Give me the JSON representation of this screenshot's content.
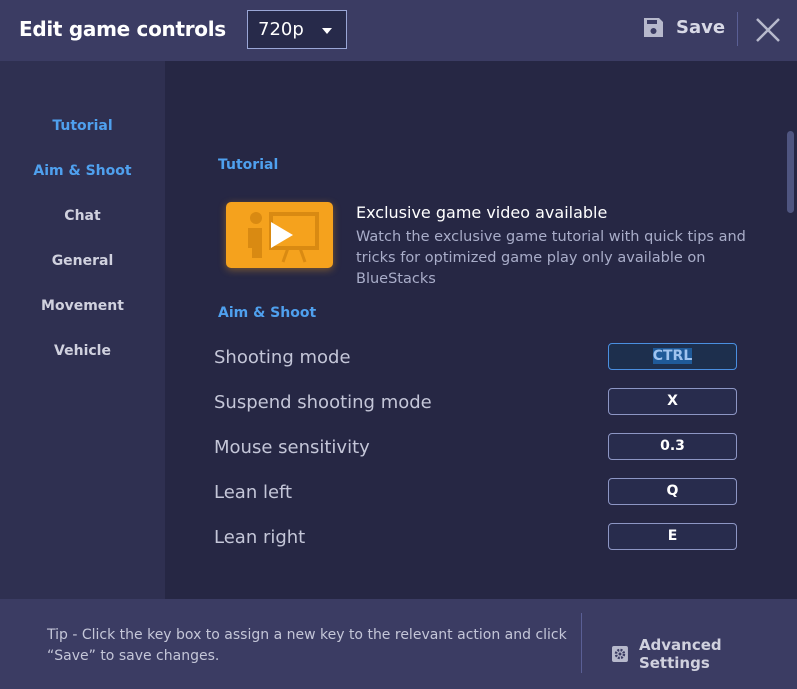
{
  "header": {
    "title": "Edit game controls",
    "resolution": "720p",
    "save_label": "Save"
  },
  "sidebar": {
    "items": [
      {
        "label": "Tutorial",
        "active": true
      },
      {
        "label": "Aim & Shoot",
        "active": true
      },
      {
        "label": "Chat"
      },
      {
        "label": "General"
      },
      {
        "label": "Movement"
      },
      {
        "label": "Vehicle"
      }
    ]
  },
  "main": {
    "tutorial_heading": "Tutorial",
    "video": {
      "title": "Exclusive game video available",
      "description": "Watch the exclusive game tutorial with quick tips and tricks for optimized game play only available on BlueStacks"
    },
    "aim_heading": "Aim & Shoot",
    "rows": [
      {
        "label": "Shooting mode",
        "key": "CTRL"
      },
      {
        "label": "Suspend shooting mode",
        "key": "X"
      },
      {
        "label": "Mouse sensitivity",
        "key": "0.3"
      },
      {
        "label": "Lean left",
        "key": "Q"
      },
      {
        "label": "Lean right",
        "key": "E"
      }
    ]
  },
  "footer": {
    "tip": "Tip - Click the key box to assign a new key to the relevant action and click “Save” to save changes.",
    "advanced_label": "Advanced Settings"
  },
  "colors": {
    "accent": "#4fa0ee",
    "video_thumb": "#f5a21d"
  }
}
